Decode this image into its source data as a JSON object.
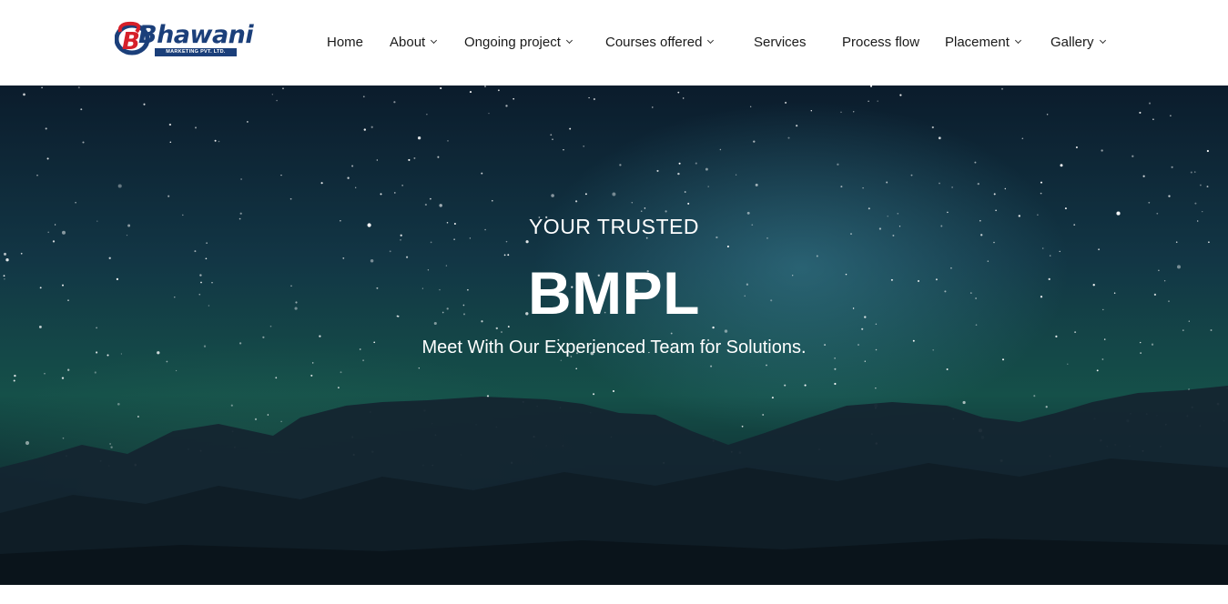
{
  "brand": {
    "logo_text": "Bhawani",
    "logo_subtext": "MARKETING PVT. LTD."
  },
  "nav": {
    "items": [
      {
        "label": "Home",
        "has_dropdown": false
      },
      {
        "label": "About",
        "has_dropdown": true
      },
      {
        "label": "Ongoing project",
        "has_dropdown": true
      },
      {
        "label": "Courses offered",
        "has_dropdown": true
      },
      {
        "label": "Services",
        "has_dropdown": false
      },
      {
        "label": "Process flow",
        "has_dropdown": false
      },
      {
        "label": "Placement",
        "has_dropdown": true
      },
      {
        "label": "Gallery",
        "has_dropdown": true
      }
    ]
  },
  "hero": {
    "kicker": "YOUR TRUSTED",
    "headline": "BMPL",
    "tagline": "Meet With Our Experienced Team for Solutions."
  },
  "colors": {
    "brand_blue": "#1b3f7a",
    "brand_red": "#d6202a",
    "hero_text": "#ffffff"
  }
}
